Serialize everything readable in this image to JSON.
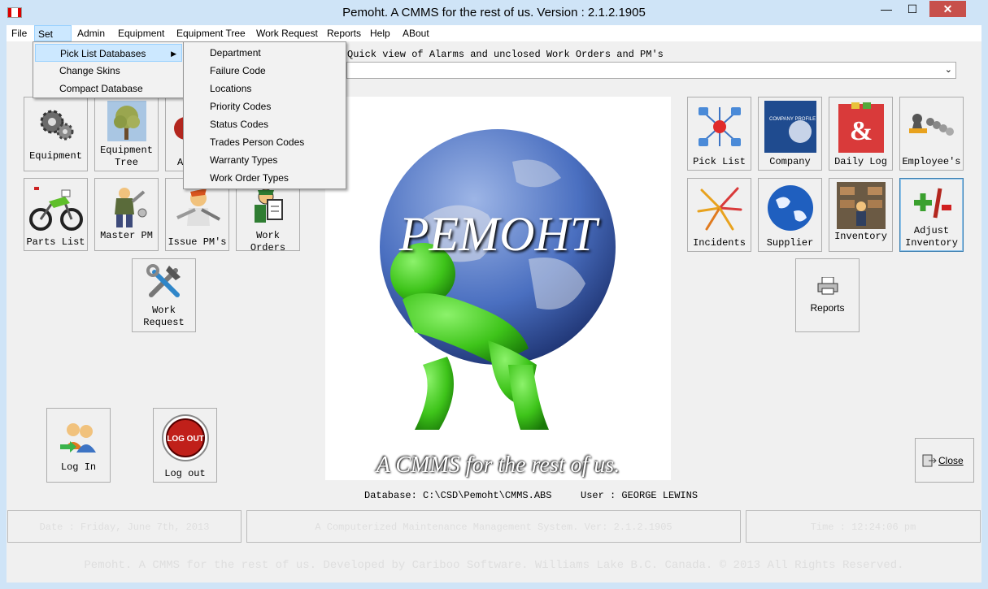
{
  "window": {
    "title": "Pemoht.  A CMMS for the rest of us.  Version : 2.1.2.1905",
    "minimize": "—",
    "maximize": "☐",
    "close": "✕"
  },
  "menubar": [
    "File",
    "Set Up",
    "Admin",
    "Equipment",
    "Equipment Tree",
    "Work Request",
    "Reports",
    "Help",
    "ABout"
  ],
  "setup_menu": {
    "items": [
      "Pick List Databases",
      "Change Skins",
      "Compact Database"
    ],
    "submenu_arrow": "▶"
  },
  "picklist_submenu": [
    "Department",
    "Failure Code",
    "Locations",
    "Priority Codes",
    "Status Codes",
    "Trades Person Codes",
    "Warranty Types",
    "Work Order Types"
  ],
  "quick_view": {
    "label": "Quick view of Alarms and unclosed Work Orders and PM's",
    "arrow": "⌄"
  },
  "left_tiles": {
    "equipment": "Equipment",
    "equipment_tree": "Equipment\nTree",
    "hidden_tile": "A",
    "parts_list": "Parts List",
    "master_pm": "Master PM",
    "issue_pms": "Issue PM's",
    "work_orders": "Work Orders",
    "work_request": "Work\nRequest",
    "log_in": "Log In",
    "log_out": "Log out",
    "log_out_badge": "LOG OUT"
  },
  "right_tiles": {
    "pick_list": "Pick List",
    "company": "Company",
    "company_badge": "COMPANY PROFILE",
    "daily_log": "Daily Log",
    "daily_log_glyph": "&",
    "employees": "Employee's",
    "incidents": "Incidents",
    "supplier": "Supplier",
    "inventory": "Inventory",
    "adjust_inventory": "Adjust\nInventory",
    "reports": "Reports",
    "close": "Close"
  },
  "splash": {
    "title": "PEMOHT",
    "tagline": "A CMMS for the rest of us."
  },
  "database_line": {
    "database": "Database: C:\\CSD\\Pemoht\\CMMS.ABS",
    "user": "User : GEORGE LEWINS"
  },
  "status_bar": {
    "date": "Date : Friday, June 7th, 2013",
    "system": "A Computerized Maintenance Management System. Ver: 2.1.2.1905",
    "time": "Time : 12:24:06 pm"
  },
  "footer": "Pemoht.  A CMMS for the rest of us.  Developed by Cariboo Software.  Williams Lake B.C. Canada. © 2013 All Rights Reserved.",
  "colors": {
    "titlebar": "#cfe4f7",
    "close_button": "#c7504b",
    "menu_highlight": "#cce8ff",
    "figure_green": "#3ec41a",
    "globe_blue": "#4a6fc0"
  }
}
